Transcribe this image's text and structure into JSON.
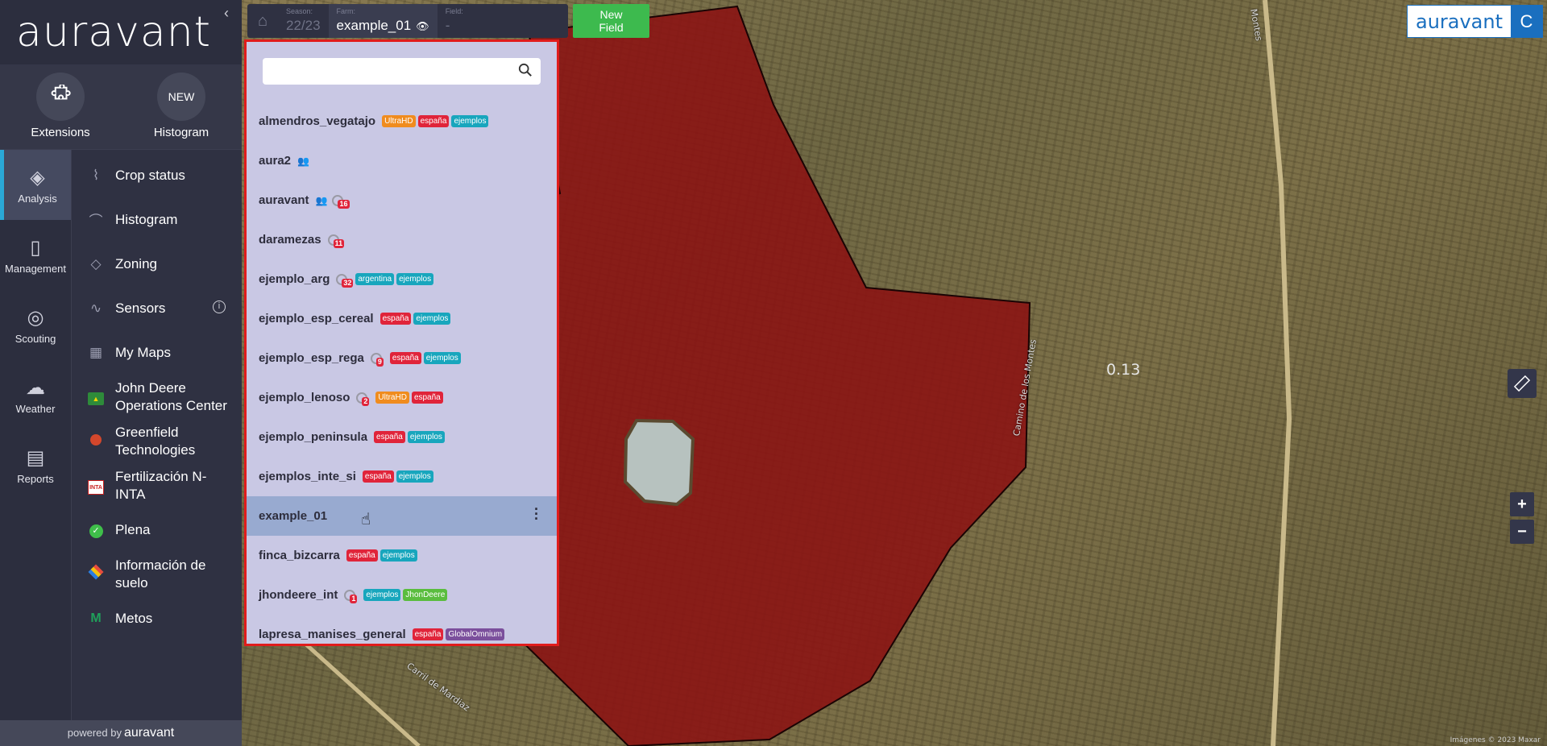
{
  "app": {
    "logo": "auravant",
    "collapse_glyph": "‹",
    "powered_prefix": "powered by",
    "powered_brand": "auravant"
  },
  "top_actions": [
    {
      "label": "Extensions",
      "icon": "puzzle-icon",
      "badge": ""
    },
    {
      "label": "Histogram",
      "icon": "",
      "badge": "NEW"
    }
  ],
  "rail": [
    {
      "label": "Analysis",
      "icon": "layers-icon",
      "glyph": "◈",
      "active": true
    },
    {
      "label": "Management",
      "icon": "notebook-icon",
      "glyph": "▯",
      "active": false
    },
    {
      "label": "Scouting",
      "icon": "map-pin-icon",
      "glyph": "◎",
      "active": false
    },
    {
      "label": "Weather",
      "icon": "cloud-icon",
      "glyph": "☁",
      "active": false
    },
    {
      "label": "Reports",
      "icon": "clipboard-icon",
      "glyph": "▤",
      "active": false
    }
  ],
  "menu": [
    {
      "label": "Crop status",
      "icon": "crop-status-icon",
      "glyph": "⌇"
    },
    {
      "label": "Histogram",
      "icon": "histogram-icon",
      "glyph": "⌒"
    },
    {
      "label": "Zoning",
      "icon": "zoning-icon",
      "glyph": "◇"
    },
    {
      "label": "Sensors",
      "icon": "sensors-icon",
      "glyph": "∿",
      "info": "i"
    },
    {
      "label": "My Maps",
      "icon": "my-maps-icon",
      "glyph": "▦"
    },
    {
      "label": "John Deere Operations Center",
      "icon": "john-deere-icon"
    },
    {
      "label": "Greenfield Technologies",
      "icon": "greenfield-icon"
    },
    {
      "label": "Fertilización N-INTA",
      "icon": "inta-icon"
    },
    {
      "label": "Plena",
      "icon": "plena-icon"
    },
    {
      "label": "Información de suelo",
      "icon": "soil-info-icon"
    },
    {
      "label": "Metos",
      "icon": "metos-icon"
    }
  ],
  "topbar": {
    "season_label": "Season:",
    "season_value": "22/23",
    "farm_label": "Farm:",
    "farm_value": "example_01",
    "field_label": "Field:",
    "field_value": "-",
    "new_field_line1": "New",
    "new_field_line2": "Field"
  },
  "search": {
    "placeholder": "",
    "value": ""
  },
  "farms": [
    {
      "name": "almendros_vegatajo",
      "shared": false,
      "sensors": null,
      "tags": [
        [
          "UltraHD",
          "orange"
        ],
        [
          "españa",
          "red"
        ],
        [
          "ejemplos",
          "teal"
        ]
      ]
    },
    {
      "name": "aura2",
      "shared": true,
      "sensors": null,
      "tags": []
    },
    {
      "name": "auravant",
      "shared": true,
      "sensors": "16",
      "tags": []
    },
    {
      "name": "daramezas",
      "shared": false,
      "sensors": "11",
      "tags": []
    },
    {
      "name": "ejemplo_arg",
      "shared": false,
      "sensors": "32",
      "tags": [
        [
          "argentina",
          "teal"
        ],
        [
          "ejemplos",
          "teal"
        ]
      ]
    },
    {
      "name": "ejemplo_esp_cereal",
      "shared": false,
      "sensors": null,
      "tags": [
        [
          "españa",
          "red"
        ],
        [
          "ejemplos",
          "teal"
        ]
      ]
    },
    {
      "name": "ejemplo_esp_rega",
      "shared": false,
      "sensors": "9",
      "tags": [
        [
          "españa",
          "red"
        ],
        [
          "ejemplos",
          "teal"
        ]
      ]
    },
    {
      "name": "ejemplo_lenoso",
      "shared": false,
      "sensors": "2",
      "tags": [
        [
          "UltraHD",
          "orange"
        ],
        [
          "españa",
          "red"
        ]
      ]
    },
    {
      "name": "ejemplo_peninsula",
      "shared": false,
      "sensors": null,
      "tags": [
        [
          "españa",
          "red"
        ],
        [
          "ejemplos",
          "teal"
        ]
      ]
    },
    {
      "name": "ejemplos_inte_si",
      "shared": false,
      "sensors": null,
      "tags": [
        [
          "españa",
          "red"
        ],
        [
          "ejemplos",
          "teal"
        ]
      ]
    },
    {
      "name": "example_01",
      "shared": false,
      "sensors": null,
      "tags": [],
      "selected": true
    },
    {
      "name": "finca_bizcarra",
      "shared": false,
      "sensors": null,
      "tags": [
        [
          "españa",
          "red"
        ],
        [
          "ejemplos",
          "teal"
        ]
      ]
    },
    {
      "name": "jhondeere_int",
      "shared": false,
      "sensors": "1",
      "tags": [
        [
          "ejemplos",
          "teal"
        ],
        [
          "JhonDeere",
          "green"
        ]
      ]
    },
    {
      "name": "lapresa_manises_general",
      "shared": false,
      "sensors": null,
      "tags": [
        [
          "españa",
          "red"
        ],
        [
          "GlobalOmnium",
          "purple"
        ]
      ]
    }
  ],
  "map": {
    "field_value": "0.13",
    "road_1": "Camino de los Montes",
    "road_2": "Montes",
    "road_3": "Carril de Mardiaz",
    "copyright": "Imágenes © 2023 Maxar",
    "brand": "auravant",
    "user_initial": "C",
    "zoom_in": "+",
    "zoom_out": "−",
    "ruler_glyph": "📏"
  },
  "colors": {
    "field_fill": "#8b1212",
    "selected_row": "#98aad0",
    "dropdown_bg": "#c9c8e4",
    "new_field": "#3dba4e",
    "accent": "#1a6fbf"
  }
}
